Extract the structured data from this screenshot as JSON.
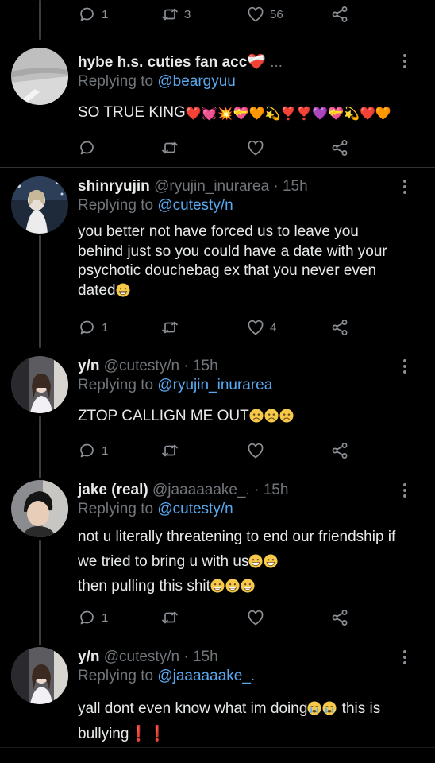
{
  "top_actions": {
    "reply_count": "1",
    "retweet_count": "3",
    "like_count": "56"
  },
  "tweets": [
    {
      "name": "hybe h.s. cuties fan acc❤️‍🩹",
      "handle": "...",
      "time": "",
      "replying_label": "Replying to",
      "replying_to": "@beargyuu",
      "text": "SO TRUE KING",
      "emojis": "❤️💓💥💝🧡💫❣️❣️💜💝💫❤️🧡",
      "reply_count": "",
      "like_count": ""
    },
    {
      "name": "shinryujin",
      "handle": "@ryujin_inurarea",
      "time": "15h",
      "replying_label": "Replying to",
      "replying_to": "@cutesty/n",
      "text": "you better not have forced us to leave you behind just so you could have a date with your psychotic douchebag ex that you never even dated",
      "reply_count": "1",
      "like_count": "4"
    },
    {
      "name": "y/n",
      "handle": "@cutesty/n",
      "time": "15h",
      "replying_label": "Replying to",
      "replying_to": "@ryujin_inurarea",
      "text": "ZTOP CALLIGN ME OUT",
      "reply_count": "1",
      "like_count": ""
    },
    {
      "name": "jake (real)",
      "handle": "@jaaaaaake_.",
      "time": "15h",
      "replying_label": "Replying to",
      "replying_to": "@cutesty/n",
      "text": "not u literally threatening to end our friendship if we tried to bring u with us",
      "text2": "then pulling this shit",
      "reply_count": "1",
      "like_count": ""
    },
    {
      "name": "y/n",
      "handle": "@cutesty/n",
      "time": "15h",
      "replying_label": "Replying to",
      "replying_to": "@jaaaaaake_.",
      "text": "yall dont even know what im doing",
      "text2": " this is bullying",
      "text3": "❗❗"
    }
  ],
  "separator": "·",
  "colors": {
    "background": "#000000",
    "mention": "#5aa8f0",
    "muted": "#71767b",
    "thread_line": "#3a3e42"
  },
  "icons": [
    "reply-icon",
    "retweet-icon",
    "like-icon",
    "share-icon",
    "more-icon"
  ]
}
